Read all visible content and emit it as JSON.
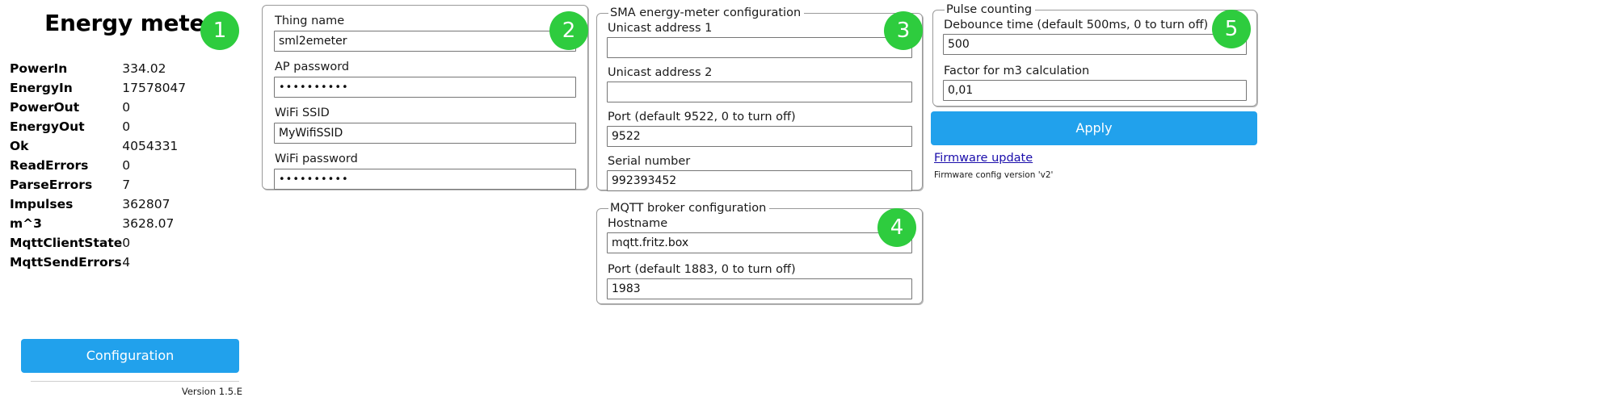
{
  "colors": {
    "badge_green": "#2ecc3e",
    "primary_blue": "#21a1ec",
    "link_blue": "#1a0dab",
    "border_grey": "#9a9a9a"
  },
  "status_panel": {
    "title": "Energy meter",
    "stats": [
      {
        "key": "PowerIn",
        "value": "334.02"
      },
      {
        "key": "EnergyIn",
        "value": "17578047"
      },
      {
        "key": "PowerOut",
        "value": "0"
      },
      {
        "key": "EnergyOut",
        "value": "0"
      },
      {
        "key": "Ok",
        "value": "4054331"
      },
      {
        "key": "ReadErrors",
        "value": "0"
      },
      {
        "key": "ParseErrors",
        "value": "7"
      },
      {
        "key": "Impulses",
        "value": "362807"
      },
      {
        "key": "m^3",
        "value": "3628.07"
      },
      {
        "key": "MqttClientState",
        "value": "0"
      },
      {
        "key": "MqttSendErrors",
        "value": "4"
      }
    ],
    "configuration_button": "Configuration",
    "version": "Version 1.5.E"
  },
  "thing_card": {
    "fields": [
      {
        "label": "Thing name",
        "value": "sml2emeter",
        "placeholder": "",
        "type": "text"
      },
      {
        "label": "AP password",
        "value": "••••••••••",
        "placeholder": "",
        "type": "password"
      },
      {
        "label": "WiFi SSID",
        "value": "MyWifiSSID",
        "placeholder": "",
        "type": "text"
      },
      {
        "label": "WiFi password",
        "value": "••••••••••",
        "placeholder": "",
        "type": "password"
      }
    ]
  },
  "sma_card": {
    "legend": "SMA energy-meter configuration",
    "fields": [
      {
        "label": "Unicast address 1",
        "value": "",
        "placeholder": ""
      },
      {
        "label": "Unicast address 2",
        "value": "",
        "placeholder": ""
      },
      {
        "label": "Port (default 9522, 0 to turn off)",
        "value": "9522",
        "placeholder": ""
      },
      {
        "label": "Serial number",
        "value": "992393452",
        "placeholder": ""
      }
    ]
  },
  "mqtt_card": {
    "legend": "MQTT broker configuration",
    "fields": [
      {
        "label": "Hostname",
        "value": "mqtt.fritz.box",
        "placeholder": ""
      },
      {
        "label": "Port (default 1883, 0 to turn off)",
        "value": "1983",
        "placeholder": ""
      }
    ]
  },
  "pulse_card": {
    "legend": "Pulse counting",
    "fields": [
      {
        "label": "Debounce time (default 500ms, 0 to turn off)",
        "value": "500",
        "placeholder": ""
      },
      {
        "label": "Factor for m3 calculation",
        "value": "0,01",
        "placeholder": ""
      }
    ]
  },
  "actions": {
    "apply_label": "Apply",
    "firmware_update_label": "Firmware update",
    "firmware_config_version": "Firmware config version 'v2'"
  },
  "badges": {
    "one": "1",
    "two": "2",
    "three": "3",
    "four": "4",
    "five": "5"
  }
}
